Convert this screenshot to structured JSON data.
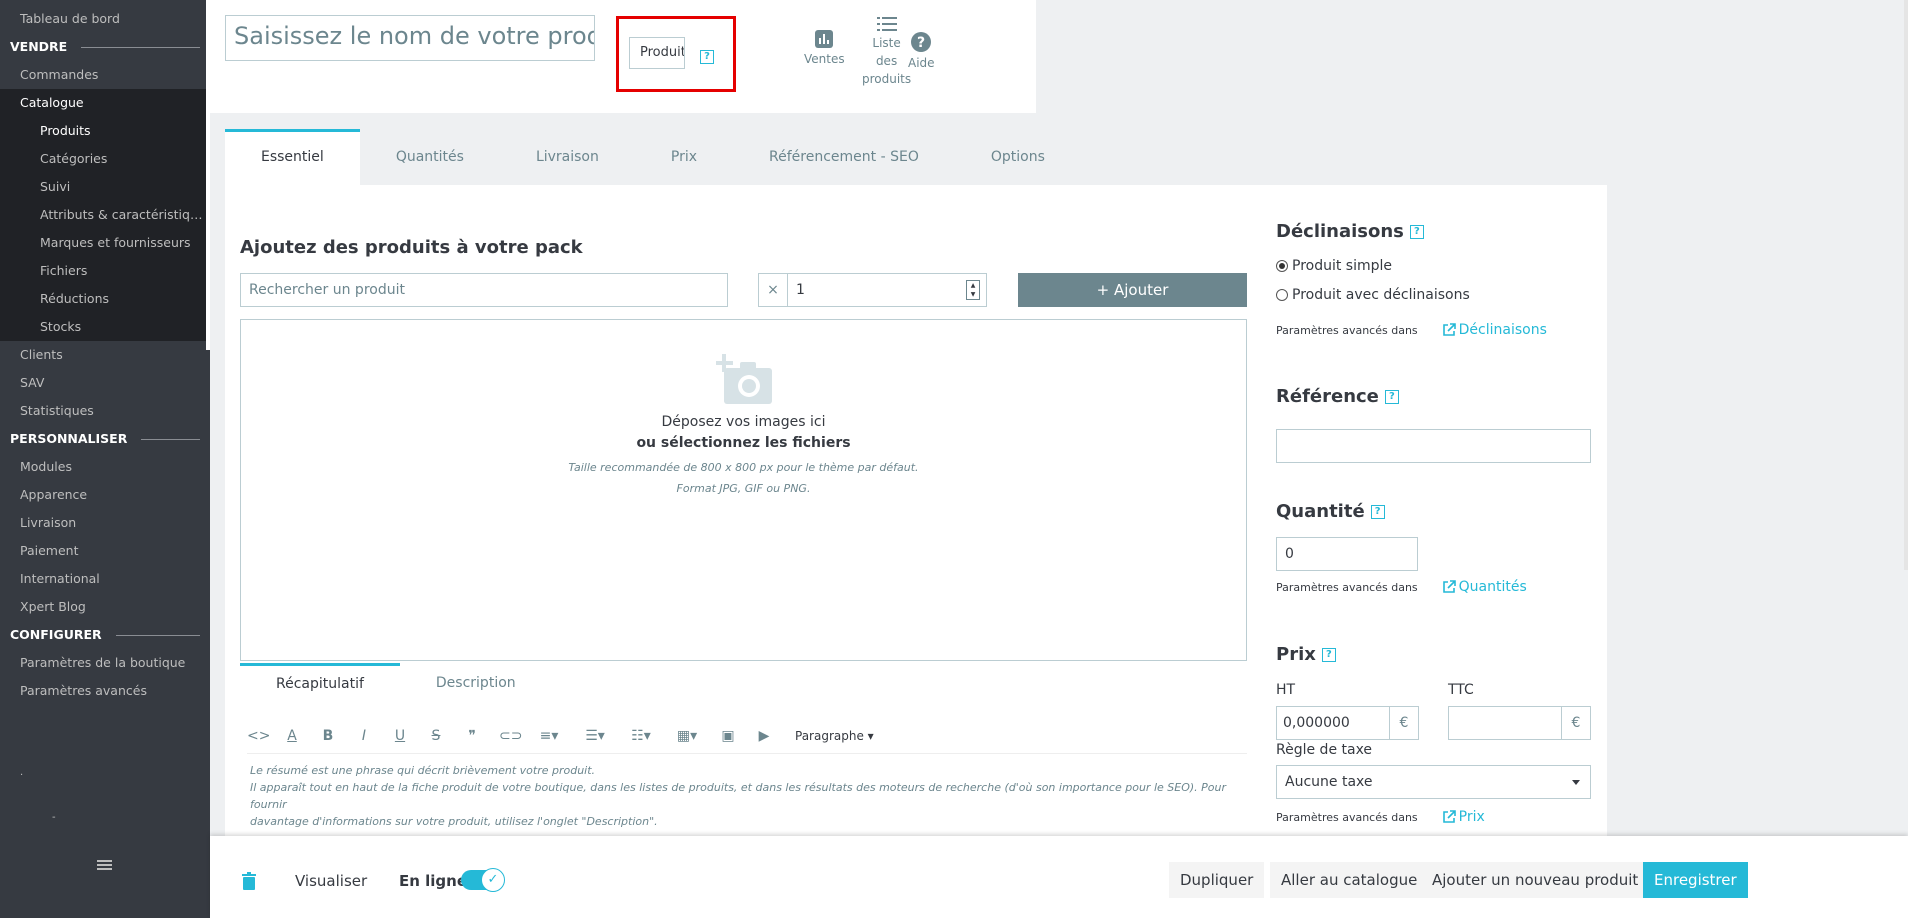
{
  "sidebar": {
    "dashboard": "Tableau de bord",
    "section_sell": "VENDRE",
    "orders": "Commandes",
    "catalog": "Catalogue",
    "catalog_items": [
      "Produits",
      "Catégories",
      "Suivi",
      "Attributs & caractéristiques",
      "Marques et fournisseurs",
      "Fichiers",
      "Réductions",
      "Stocks"
    ],
    "clients": "Clients",
    "sav": "SAV",
    "stats": "Statistiques",
    "section_customize": "PERSONNALISER",
    "customize_items": [
      "Modules",
      "Apparence",
      "Livraison",
      "Paiement",
      "International",
      "Xpert Blog"
    ],
    "section_configure": "CONFIGURER",
    "configure_items": [
      "Paramètres de la boutique",
      "Paramètres avancés"
    ]
  },
  "header": {
    "name_placeholder": "Saisissez le nom de votre produit",
    "type_select_value": "Produit",
    "help_glyph": "?",
    "buttons": {
      "sales": "Ventes",
      "product_list": [
        "Liste",
        "des",
        "produits"
      ],
      "help": "Aide"
    }
  },
  "tabs": [
    "Essentiel",
    "Quantités",
    "Livraison",
    "Prix",
    "Référencement - SEO",
    "Options"
  ],
  "pack": {
    "title": "Ajoutez des produits à votre pack",
    "search_placeholder": "Rechercher un produit",
    "qty_prefix": "×",
    "qty_value": "1",
    "add_label": "Ajouter"
  },
  "dropzone": {
    "line1": "Déposez vos images ici",
    "line2": "ou sélectionnez les fichiers",
    "line3": "Taille recommandée de 800 x 800 px pour le thème par défaut.",
    "line4": "Format JPG, GIF ou PNG."
  },
  "editor": {
    "tabs": [
      "Récapitulatif",
      "Description"
    ],
    "paragraph_label": "Paragraphe",
    "summary_line1": "Le résumé est une phrase qui décrit brièvement votre produit.",
    "summary_line2": "Il apparaît tout en haut de la fiche produit de votre boutique, dans les listes de produits, et dans les résultats des moteurs de recherche (d'où son importance pour le SEO). Pour fournir",
    "summary_line3": "davantage d'informations sur votre produit, utilisez l'onglet \"Description\"."
  },
  "right": {
    "variants_title": "Déclinaisons",
    "simple_product": "Produit simple",
    "variant_product": "Produit avec déclinaisons",
    "advanced_label": "Paramètres avancés dans",
    "variants_link": "Déclinaisons",
    "reference_title": "Référence",
    "quantity_title": "Quantité",
    "quantity_value": "0",
    "quantities_link": "Quantités",
    "price_title": "Prix",
    "ht_label": "HT",
    "ttc_label": "TTC",
    "ht_value": "0,000000",
    "currency": "€",
    "tax_label": "Règle de taxe",
    "tax_value": "Aucune taxe",
    "price_link": "Prix"
  },
  "footer": {
    "preview": "Visualiser",
    "online": "En ligne",
    "duplicate": "Dupliquer",
    "go_catalog": "Aller au catalogue",
    "add_new": "Ajouter un nouveau produit",
    "save": "Enregistrer"
  }
}
